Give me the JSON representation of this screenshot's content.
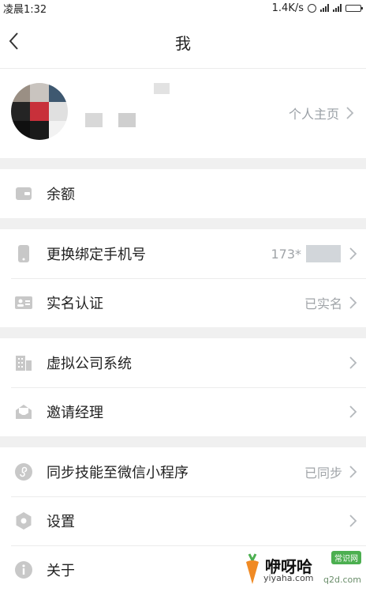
{
  "status_bar": {
    "time": "凌晨1:32",
    "speed": "1.4K/s"
  },
  "header": {
    "title": "我"
  },
  "profile": {
    "homepage_link": "个人主页"
  },
  "groups": [
    [
      {
        "name": "balance",
        "label": "余额",
        "value": ""
      }
    ],
    [
      {
        "name": "change-phone",
        "label": "更换绑定手机号",
        "value": "173*"
      },
      {
        "name": "real-name",
        "label": "实名认证",
        "value": "已实名"
      }
    ],
    [
      {
        "name": "virtual-company",
        "label": "虚拟公司系统",
        "value": ""
      },
      {
        "name": "invite-manager",
        "label": "邀请经理",
        "value": ""
      }
    ],
    [
      {
        "name": "sync-skills",
        "label": "同步技能至微信小程序",
        "value": "已同步"
      },
      {
        "name": "settings",
        "label": "设置",
        "value": ""
      },
      {
        "name": "about",
        "label": "关于",
        "value": ""
      }
    ]
  ],
  "watermark": {
    "brand": "咿呀哈",
    "domain": "yiyaha.com",
    "badge": "常识网",
    "corner": "q2d.com"
  },
  "colors": {
    "icon_gray": "#c8c8c8",
    "value_gray": "#a0a4a8",
    "background": "#f0f0f0"
  }
}
